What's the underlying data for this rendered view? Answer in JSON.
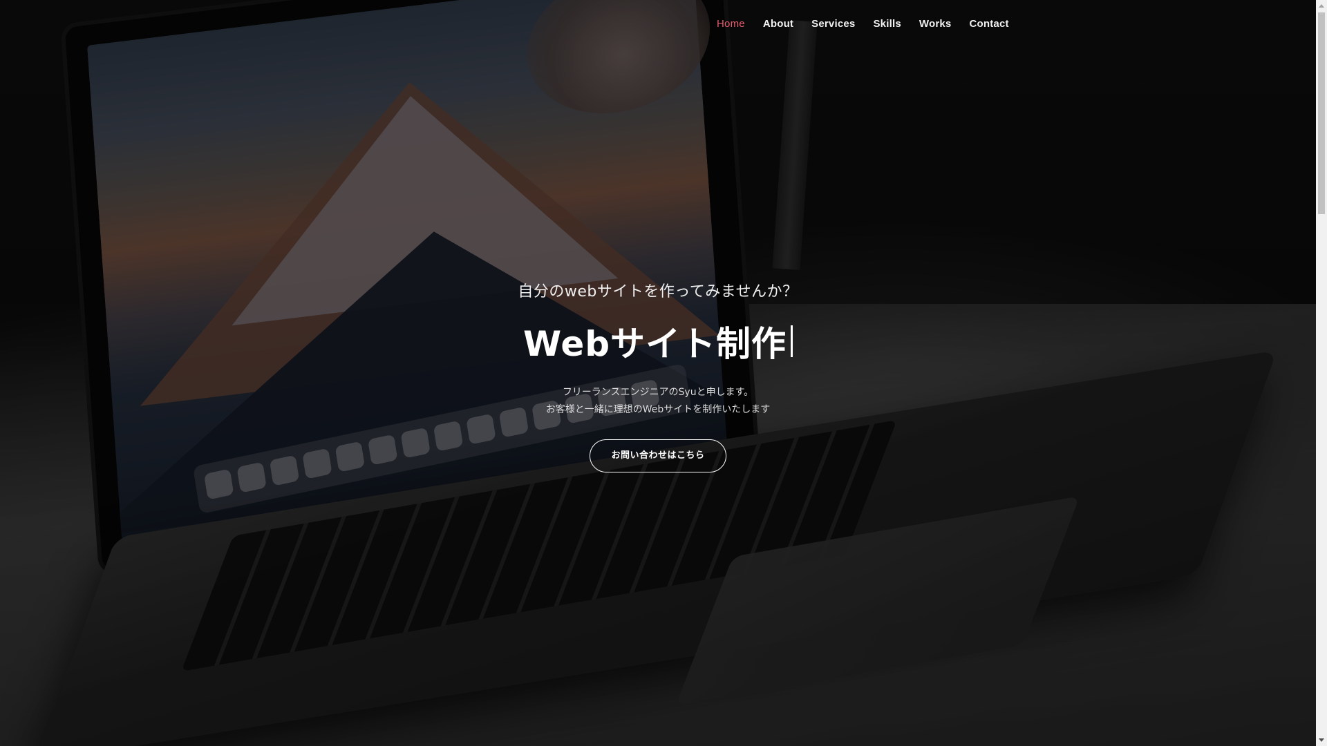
{
  "nav": {
    "items": [
      {
        "label": "Home",
        "active": true
      },
      {
        "label": "About",
        "active": false
      },
      {
        "label": "Services",
        "active": false
      },
      {
        "label": "Skills",
        "active": false
      },
      {
        "label": "Works",
        "active": false
      },
      {
        "label": "Contact",
        "active": false
      }
    ]
  },
  "hero": {
    "subtitle": "自分のwebサイトを作ってみませんか？",
    "title": "Webサイト制作",
    "description_line1": "フリーランスエンジニアのSyuと申します。",
    "description_line2": "お客様と一緒に理想のWebサイトを制作いたします",
    "cta_label": "お問い合わせはこちら"
  },
  "colors": {
    "active_nav": "#e85d6f",
    "text": "#ffffff"
  }
}
